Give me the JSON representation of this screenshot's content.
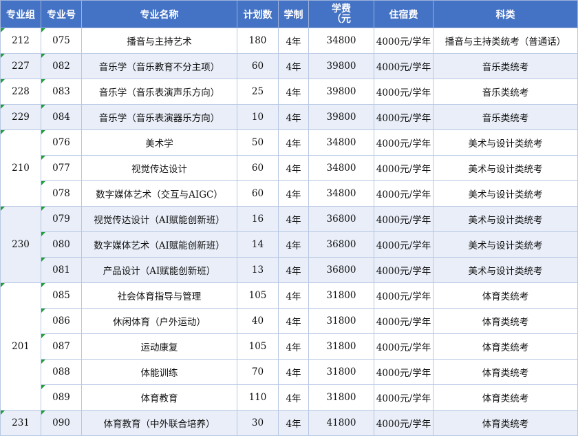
{
  "headers": {
    "group": "专业组",
    "code": "专业号",
    "name": "专业名称",
    "plan": "计划数",
    "years": "学制",
    "fee_line1": "学费",
    "fee_line2": "（元",
    "dorm": "住宿费",
    "category": "科类"
  },
  "groups": [
    {
      "group": "212",
      "rows": [
        {
          "code": "075",
          "name": "播音与主持艺术",
          "plan": "180",
          "years": "4年",
          "fee": "34800",
          "dorm": "4000元/学年",
          "category": "播音与主持类统考（普通话）"
        }
      ]
    },
    {
      "group": "227",
      "rows": [
        {
          "code": "082",
          "name": "音乐学（音乐教育不分主项）",
          "plan": "60",
          "years": "4年",
          "fee": "39800",
          "dorm": "4000元/学年",
          "category": "音乐类统考"
        }
      ]
    },
    {
      "group": "228",
      "rows": [
        {
          "code": "083",
          "name": "音乐学（音乐表演声乐方向）",
          "plan": "25",
          "years": "4年",
          "fee": "39800",
          "dorm": "4000元/学年",
          "category": "音乐类统考"
        }
      ]
    },
    {
      "group": "229",
      "rows": [
        {
          "code": "084",
          "name": "音乐学（音乐表演器乐方向）",
          "plan": "10",
          "years": "4年",
          "fee": "39800",
          "dorm": "4000元/学年",
          "category": "音乐类统考"
        }
      ]
    },
    {
      "group": "210",
      "rows": [
        {
          "code": "076",
          "name": "美术学",
          "plan": "50",
          "years": "4年",
          "fee": "34800",
          "dorm": "4000元/学年",
          "category": "美术与设计类统考"
        },
        {
          "code": "077",
          "name": "视觉传达设计",
          "plan": "60",
          "years": "4年",
          "fee": "34800",
          "dorm": "4000元/学年",
          "category": "美术与设计类统考"
        },
        {
          "code": "078",
          "name": "数字媒体艺术（交互与AIGC）",
          "plan": "60",
          "years": "4年",
          "fee": "34800",
          "dorm": "4000元/学年",
          "category": "美术与设计类统考"
        }
      ]
    },
    {
      "group": "230",
      "rows": [
        {
          "code": "079",
          "name": "视觉传达设计（AI赋能创新班）",
          "plan": "16",
          "years": "4年",
          "fee": "36800",
          "dorm": "4000元/学年",
          "category": "美术与设计类统考"
        },
        {
          "code": "080",
          "name": "数字媒体艺术（AI赋能创新班）",
          "plan": "14",
          "years": "4年",
          "fee": "36800",
          "dorm": "4000元/学年",
          "category": "美术与设计类统考"
        },
        {
          "code": "081",
          "name": "产品设计（AI赋能创新班）",
          "plan": "13",
          "years": "4年",
          "fee": "36800",
          "dorm": "4000元/学年",
          "category": "美术与设计类统考"
        }
      ]
    },
    {
      "group": "201",
      "rows": [
        {
          "code": "085",
          "name": "社会体育指导与管理",
          "plan": "105",
          "years": "4年",
          "fee": "31800",
          "dorm": "4000元/学年",
          "category": "体育类统考"
        },
        {
          "code": "086",
          "name": "休闲体育（户外运动）",
          "plan": "40",
          "years": "4年",
          "fee": "31800",
          "dorm": "4000元/学年",
          "category": "体育类统考"
        },
        {
          "code": "087",
          "name": "运动康复",
          "plan": "105",
          "years": "4年",
          "fee": "31800",
          "dorm": "4000元/学年",
          "category": "体育类统考"
        },
        {
          "code": "088",
          "name": "体能训练",
          "plan": "70",
          "years": "4年",
          "fee": "31800",
          "dorm": "4000元/学年",
          "category": "体育类统考"
        },
        {
          "code": "089",
          "name": "体育教育",
          "plan": "110",
          "years": "4年",
          "fee": "31800",
          "dorm": "4000元/学年",
          "category": "体育类统考"
        }
      ]
    },
    {
      "group": "231",
      "rows": [
        {
          "code": "090",
          "name": "体育教育（中外联合培养）",
          "plan": "30",
          "years": "4年",
          "fee": "41800",
          "dorm": "4000元/学年",
          "category": "体育类统考"
        }
      ]
    }
  ],
  "colors": {
    "header_bg": "#4472c4",
    "alt_row_bg": "#e9eef8",
    "border": "#b7c7e3",
    "corner_mark": "#1f9e3a"
  }
}
